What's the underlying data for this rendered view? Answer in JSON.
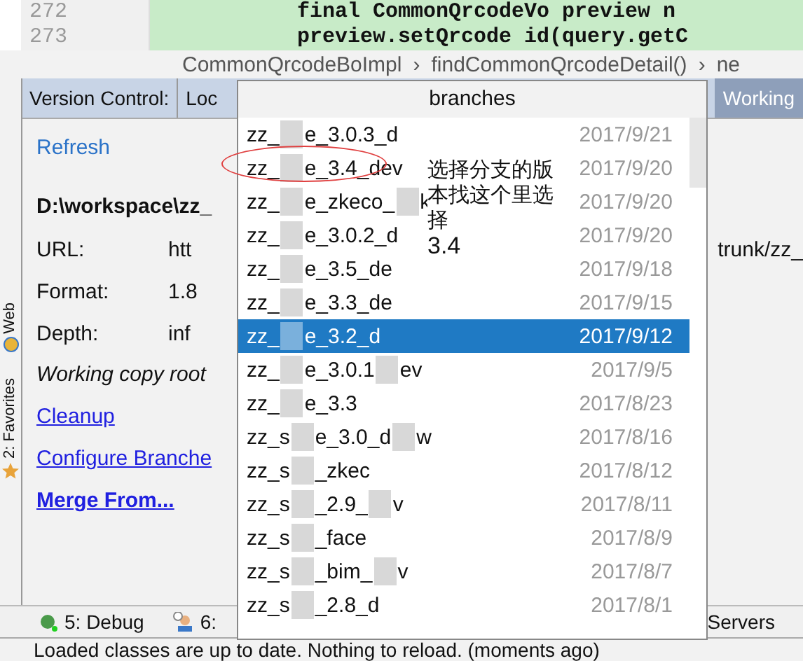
{
  "editor": {
    "lines": [
      {
        "number": "272",
        "code": "final CommonQrcodeVo preview n"
      },
      {
        "number": "273",
        "code": "preview.setQrcode id(query.getC"
      }
    ]
  },
  "breadcrumbs": [
    "CommonQrcodeBoImpl",
    "findCommonQrcodeDetail()",
    "ne"
  ],
  "breadcrumb_separator": "›",
  "tool_window": {
    "title": "Version Control:",
    "tabs": [
      {
        "label": "Loc",
        "selected": false
      },
      {
        "label": "Working",
        "selected": true
      }
    ]
  },
  "side_strip": [
    {
      "label": "Web"
    },
    {
      "label": "2: Favorites"
    }
  ],
  "panel": {
    "refresh": "Refresh",
    "path": "D:\\workspace\\zz_",
    "fields": [
      {
        "label": "URL:",
        "value": "htt",
        "tail": "trunk/zz_"
      },
      {
        "label": "Format:",
        "value": "1.8"
      },
      {
        "label": "Depth:",
        "value": "inf"
      }
    ],
    "note": "Working copy root",
    "links": [
      {
        "label": "Cleanup",
        "bold": false
      },
      {
        "label": "Configure Branche",
        "bold": false
      },
      {
        "label": "Merge From...",
        "bold": true
      }
    ]
  },
  "bottom_tabs": [
    {
      "label": "5: Debug",
      "kind": "debug"
    },
    {
      "label": "6:",
      "kind": "person"
    },
    {
      "label": "Servers",
      "kind": "plain"
    }
  ],
  "status_bar": "Loaded classes are up to date. Nothing to reload. (moments ago)",
  "popup": {
    "title": "branches",
    "items": [
      {
        "prefix": "zz_",
        "name": "e_3.0.3_d",
        "date": "2017/9/21",
        "selected": false
      },
      {
        "prefix": "zz_",
        "name": "e_3.4_dev",
        "date": "2017/9/20",
        "selected": false
      },
      {
        "prefix": "zz_",
        "name": "e_zkeco_",
        "tail": "k",
        "date": "2017/9/20",
        "selected": false
      },
      {
        "prefix": "zz_",
        "name": "e_3.0.2_d",
        "date": "2017/9/20",
        "selected": false
      },
      {
        "prefix": "zz_",
        "name": "e_3.5_de",
        "date": "2017/9/18",
        "selected": false
      },
      {
        "prefix": "zz_",
        "name": "e_3.3_de",
        "date": "2017/9/15",
        "selected": false
      },
      {
        "prefix": "zz_",
        "name": "e_3.2_d",
        "date": "2017/9/12",
        "selected": true
      },
      {
        "prefix": "zz_",
        "name": "e_3.0.1",
        "tail": "ev",
        "date": "2017/9/5",
        "selected": false
      },
      {
        "prefix": "zz_",
        "name": "e_3.3",
        "date": "2017/8/23",
        "selected": false
      },
      {
        "prefix": "zz_s",
        "name": "e_3.0_d",
        "tail": "w",
        "date": "2017/8/16",
        "selected": false
      },
      {
        "prefix": "zz_s",
        "name": "_zkec",
        "date": "2017/8/12",
        "selected": false
      },
      {
        "prefix": "zz_s",
        "name": "_2.9_",
        "tail": "v",
        "date": "2017/8/11",
        "selected": false
      },
      {
        "prefix": "zz_s",
        "name": "_face",
        "date": "2017/8/9",
        "selected": false
      },
      {
        "prefix": "zz_s",
        "name": "_bim_",
        "tail": "v",
        "date": "2017/8/7",
        "selected": false
      },
      {
        "prefix": "zz_s",
        "name": "_2.8_d",
        "date": "2017/8/1",
        "selected": false
      }
    ]
  },
  "annotation": {
    "text": "选择分支的版本找这个里选择",
    "value": "3.4"
  }
}
